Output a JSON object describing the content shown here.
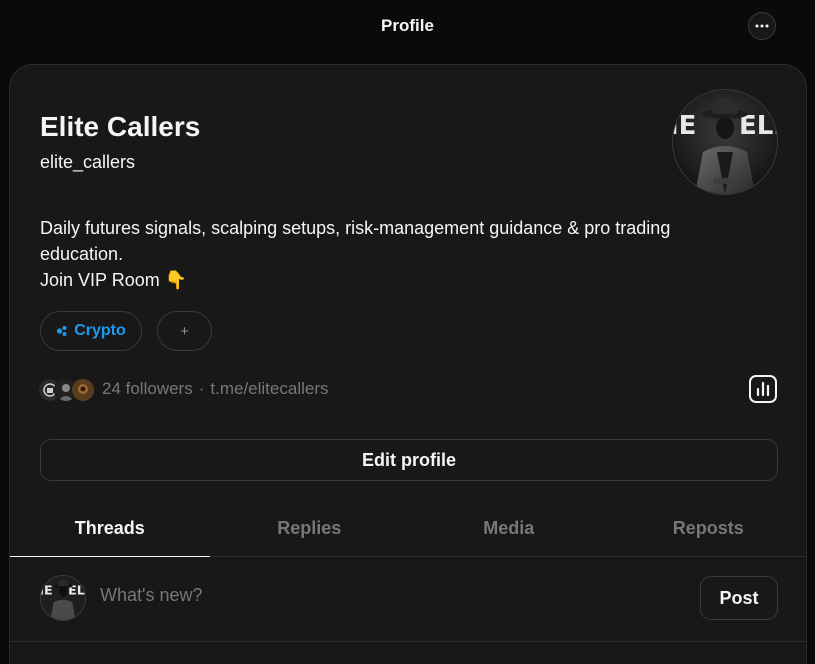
{
  "header": {
    "title": "Profile",
    "more_icon": "more-horizontal-icon"
  },
  "profile": {
    "name": "Elite Callers",
    "handle": "elite_callers",
    "avatar_text": "E ELI",
    "bio_lines": [
      "Daily futures signals, scalping setups, risk-management guidance & pro trading",
      "education.",
      "Join VIP Room 👇"
    ],
    "tag": {
      "label": "Crypto",
      "icon": "topic-dots-icon",
      "color": "#1d9bf0"
    },
    "add_tag_label": "+",
    "followers_text": "24 followers",
    "separator": "·",
    "link_text": "t.me/elitecallers",
    "insights_icon": "bar-chart-icon",
    "edit_button_label": "Edit profile"
  },
  "tabs": [
    {
      "label": "Threads",
      "active": true
    },
    {
      "label": "Replies",
      "active": false
    },
    {
      "label": "Media",
      "active": false
    },
    {
      "label": "Reposts",
      "active": false
    }
  ],
  "composer": {
    "placeholder": "What's new?",
    "post_label": "Post"
  },
  "colors": {
    "background": "#0a0a0a",
    "card": "#181818",
    "border": "#2d2d2d",
    "text_primary": "#f3f5f7",
    "text_secondary": "#777777",
    "accent": "#1d9bf0"
  }
}
